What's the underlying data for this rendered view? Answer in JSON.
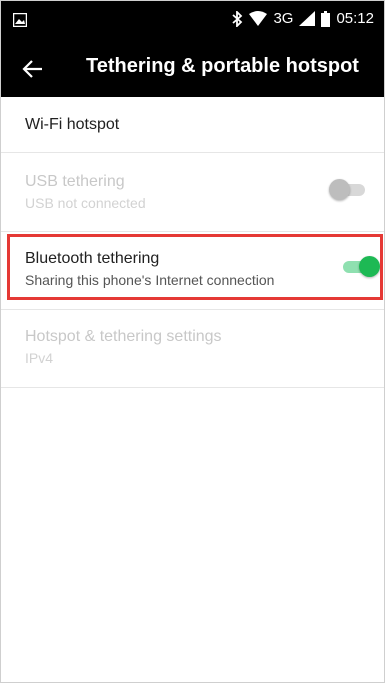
{
  "status_bar": {
    "network_type": "3G",
    "time": "05:12",
    "icons": [
      "image-icon",
      "bluetooth-icon",
      "wifi-icon",
      "signal-icon",
      "battery-icon"
    ]
  },
  "app_bar": {
    "back_icon": "arrow-left-icon",
    "title": "Tethering & portable hotspot"
  },
  "items": [
    {
      "title": "Wi-Fi hotspot",
      "subtitle": "",
      "enabled": true
    },
    {
      "title": "USB tethering",
      "subtitle": "USB not connected",
      "enabled": false,
      "toggle": "off"
    },
    {
      "title": "Bluetooth tethering",
      "subtitle": "Sharing this phone's Internet connection",
      "enabled": true,
      "toggle": "on"
    },
    {
      "title": "Hotspot & tethering settings",
      "subtitle": "IPv4",
      "enabled": false
    }
  ],
  "colors": {
    "bar_background": "#000000",
    "toggle_on": "#1db954",
    "toggle_on_track": "#8fe0b0",
    "highlight_box": "#e53935",
    "disabled_text": "#c8c8c8"
  }
}
